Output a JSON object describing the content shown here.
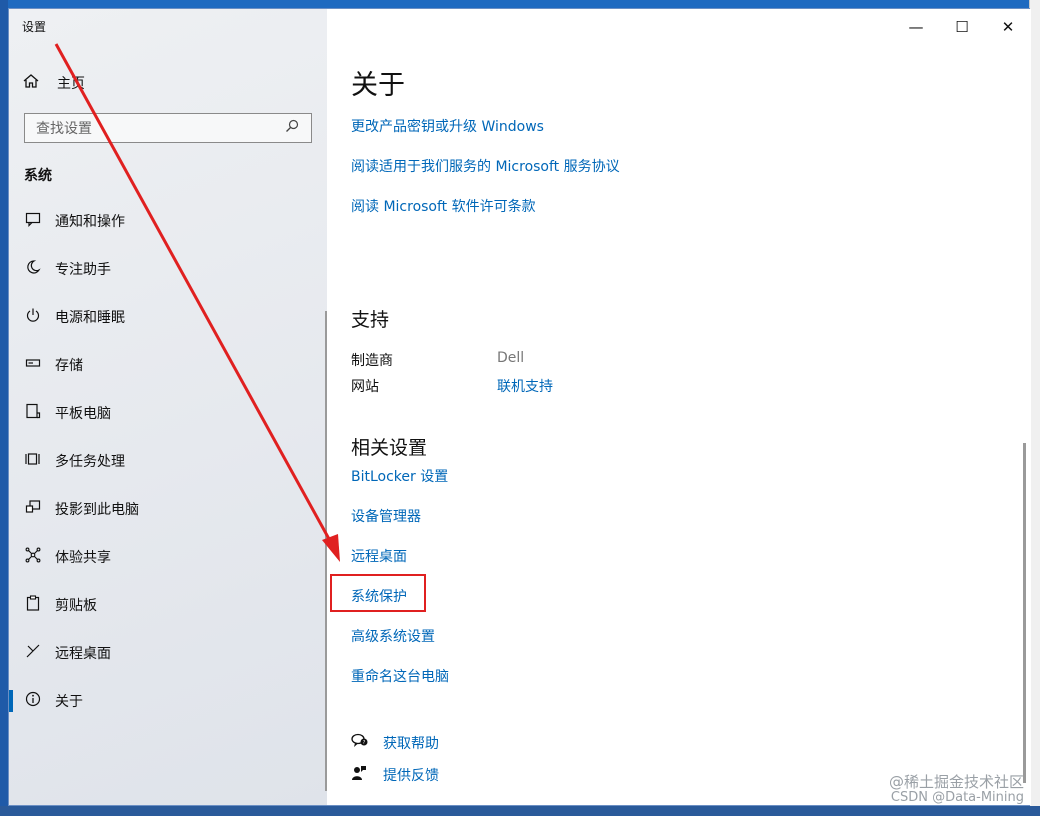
{
  "window": {
    "title": "设置",
    "controls": {
      "minimize": "—",
      "maximize": "☐",
      "close": "✕"
    }
  },
  "sidebar": {
    "home": {
      "icon": "home-icon",
      "label": "主页"
    },
    "search": {
      "placeholder": "查找设置",
      "icon": "search-icon"
    },
    "section_title": "系统",
    "items": [
      {
        "icon": "notification-icon",
        "label": "通知和操作"
      },
      {
        "icon": "moon-icon",
        "label": "专注助手"
      },
      {
        "icon": "power-icon",
        "label": "电源和睡眠"
      },
      {
        "icon": "storage-icon",
        "label": "存储"
      },
      {
        "icon": "tablet-icon",
        "label": "平板电脑"
      },
      {
        "icon": "multitask-icon",
        "label": "多任务处理"
      },
      {
        "icon": "project-icon",
        "label": "投影到此电脑"
      },
      {
        "icon": "share-icon",
        "label": "体验共享"
      },
      {
        "icon": "clipboard-icon",
        "label": "剪贴板"
      },
      {
        "icon": "remote-icon",
        "label": "远程桌面"
      },
      {
        "icon": "info-icon",
        "label": "关于",
        "active": true
      }
    ]
  },
  "main": {
    "title": "关于",
    "top_links": [
      "更改产品密钥或升级 Windows",
      "阅读适用于我们服务的 Microsoft 服务协议",
      "阅读 Microsoft 软件许可条款"
    ],
    "support": {
      "heading": "支持",
      "manufacturer_label": "制造商",
      "manufacturer_value": "Dell",
      "website_label": "网站",
      "website_value": "联机支持"
    },
    "related": {
      "heading": "相关设置",
      "links": [
        "BitLocker 设置",
        "设备管理器",
        "远程桌面",
        "系统保护",
        "高级系统设置",
        "重命名这台电脑"
      ]
    },
    "help": [
      {
        "icon": "help-chat-icon",
        "label": "获取帮助"
      },
      {
        "icon": "feedback-icon",
        "label": "提供反馈"
      }
    ]
  },
  "annotation": {
    "highlight_color": "#e02020",
    "highlighted_link": "系统保护"
  },
  "watermark": {
    "line1": "@稀土掘金技术社区",
    "line2": "CSDN @Data-Mining"
  }
}
